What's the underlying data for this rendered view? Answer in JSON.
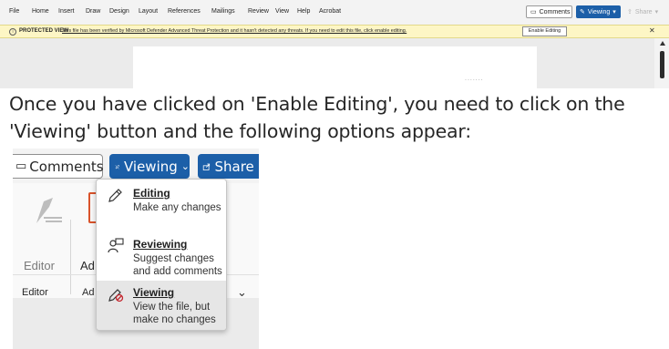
{
  "top_screenshot": {
    "menu": [
      "File",
      "Home",
      "Insert",
      "Draw",
      "Design",
      "Layout",
      "References",
      "Mailings",
      "Review",
      "View",
      "Help",
      "Acrobat"
    ],
    "comments_label": "Comments",
    "viewing_label": "Viewing",
    "share_label": "Share",
    "protected_title": "PROTECTED VIEW",
    "protected_message": "This file has been verified by Microsoft Defender Advanced Threat Protection and it hasn't detected any threats. If you need to edit this file, click enable editing.",
    "enable_editing_label": "Enable Editing",
    "close_glyph": "✕",
    "doc_dots": "......."
  },
  "instruction": "Once you have clicked on 'Enable Editing', you need to click on the 'Viewing' button and the following options appear:",
  "zoom_screenshot": {
    "comments_label": "Comments",
    "viewing_label": "Viewing",
    "share_label": "Share",
    "ribbon": {
      "editor_label": "Editor",
      "ad_label": "Ad",
      "group_editor": "Editor",
      "group_ad": "Ad"
    },
    "dropdown": [
      {
        "icon": "pencil-icon",
        "title": "Editing",
        "description": "Make any changes"
      },
      {
        "icon": "review-icon",
        "title": "Reviewing",
        "description": "Suggest changes and add comments"
      },
      {
        "icon": "viewing-icon",
        "title": "Viewing",
        "description": "View the file, but make no changes"
      }
    ]
  },
  "colors": {
    "accent_blue": "#1c5fa8",
    "protected_bar": "#fdf6c5",
    "selected_option": "#e6e6e6"
  }
}
